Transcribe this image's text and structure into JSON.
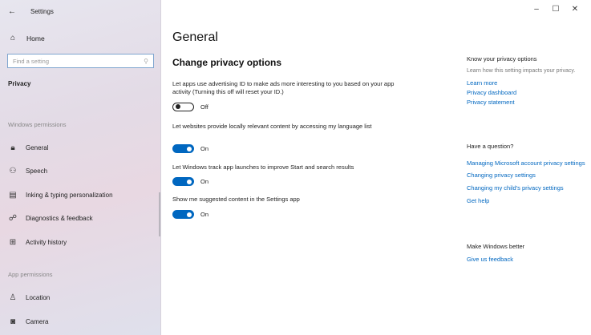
{
  "sidebar": {
    "back_glyph": "←",
    "app_title": "Settings",
    "home_label": "Home",
    "search_placeholder": "Find a setting",
    "section": "Privacy",
    "group1": "Windows permissions",
    "items": [
      {
        "label": "General",
        "icon": "lock-icon"
      },
      {
        "label": "Speech",
        "icon": "speech-icon"
      },
      {
        "label": "Inking & typing personalization",
        "icon": "inking-icon"
      },
      {
        "label": "Diagnostics & feedback",
        "icon": "feedback-icon"
      },
      {
        "label": "Activity history",
        "icon": "activity-icon"
      }
    ],
    "group2": "App permissions",
    "app_items": [
      {
        "label": "Location",
        "icon": "location-icon"
      },
      {
        "label": "Camera",
        "icon": "camera-icon"
      }
    ]
  },
  "window": {
    "minimize": "–",
    "maximize": "☐",
    "close": "✕"
  },
  "main": {
    "title": "General",
    "section_title": "Change privacy options",
    "settings": [
      {
        "desc": "Let apps use advertising ID to make ads more interesting to you based on your app activity (Turning this off will reset your ID.)",
        "state": "Off",
        "on": false
      },
      {
        "desc": "Let websites provide locally relevant content by accessing my language list",
        "state": "On",
        "on": true
      },
      {
        "desc": "Let Windows track app launches to improve Start and search results",
        "state": "On",
        "on": true
      },
      {
        "desc": "Show me suggested content in the Settings app",
        "state": "On",
        "on": true
      }
    ]
  },
  "right": {
    "know": {
      "heading": "Know your privacy options",
      "text": "Learn how this setting impacts your privacy.",
      "links": [
        "Learn more",
        "Privacy dashboard",
        "Privacy statement"
      ]
    },
    "question": {
      "heading": "Have a question?",
      "links": [
        "Managing Microsoft account privacy settings",
        "Changing privacy settings",
        "Changing my child's privacy settings",
        "Get help"
      ]
    },
    "better": {
      "heading": "Make Windows better",
      "links": [
        "Give us feedback"
      ]
    }
  },
  "colors": {
    "accent": "#0067c0"
  }
}
